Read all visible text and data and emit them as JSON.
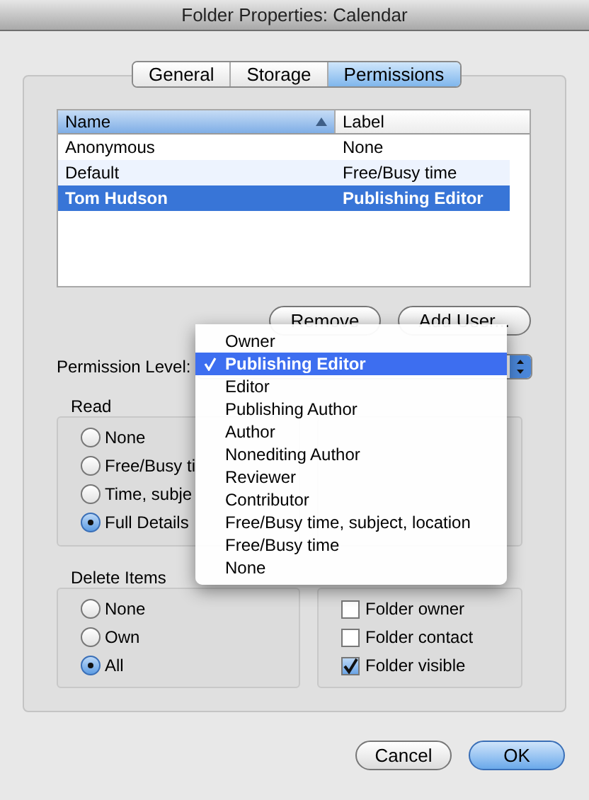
{
  "window": {
    "title": "Folder Properties: Calendar"
  },
  "tabs": [
    {
      "label": "General",
      "selected": false
    },
    {
      "label": "Storage",
      "selected": false
    },
    {
      "label": "Permissions",
      "selected": true
    }
  ],
  "table": {
    "columns": [
      {
        "label": "Name",
        "sorted": true
      },
      {
        "label": "Label",
        "sorted": false
      }
    ],
    "rows": [
      {
        "cells": [
          "Anonymous",
          "None"
        ],
        "selected": false
      },
      {
        "cells": [
          "Default",
          "Free/Busy time"
        ],
        "selected": false
      },
      {
        "cells": [
          "Tom Hudson",
          "Publishing Editor"
        ],
        "selected": true
      }
    ]
  },
  "table_buttons": [
    {
      "label": "Remove"
    },
    {
      "label": "Add User..."
    }
  ],
  "permission_level": {
    "label": "Permission Level:",
    "menu": [
      {
        "label": "Owner",
        "selected": false
      },
      {
        "label": "Publishing Editor",
        "selected": true
      },
      {
        "label": "Editor",
        "selected": false
      },
      {
        "label": "Publishing Author",
        "selected": false
      },
      {
        "label": "Author",
        "selected": false
      },
      {
        "label": "Nonediting Author",
        "selected": false
      },
      {
        "label": "Reviewer",
        "selected": false
      },
      {
        "label": "Contributor",
        "selected": false
      },
      {
        "label": "Free/Busy time, subject, location",
        "selected": false
      },
      {
        "label": "Free/Busy time",
        "selected": false
      },
      {
        "label": "None",
        "selected": false
      }
    ]
  },
  "read": {
    "title": "Read",
    "options": [
      {
        "label": "None",
        "selected": false
      },
      {
        "label": "Free/Busy ti",
        "selected": false
      },
      {
        "label": "Time, subje",
        "selected": false
      },
      {
        "label": "Full Details",
        "selected": true
      }
    ]
  },
  "delete_items": {
    "title": "Delete Items",
    "options": [
      {
        "label": "None",
        "selected": false
      },
      {
        "label": "Own",
        "selected": false
      },
      {
        "label": "All",
        "selected": true
      }
    ]
  },
  "other": {
    "options": [
      {
        "label": "Folder owner",
        "checked": false
      },
      {
        "label": "Folder contact",
        "checked": false
      },
      {
        "label": "Folder visible",
        "checked": true
      }
    ]
  },
  "footer_buttons": [
    {
      "label": "Cancel",
      "default": false
    },
    {
      "label": "OK",
      "default": true
    }
  ]
}
